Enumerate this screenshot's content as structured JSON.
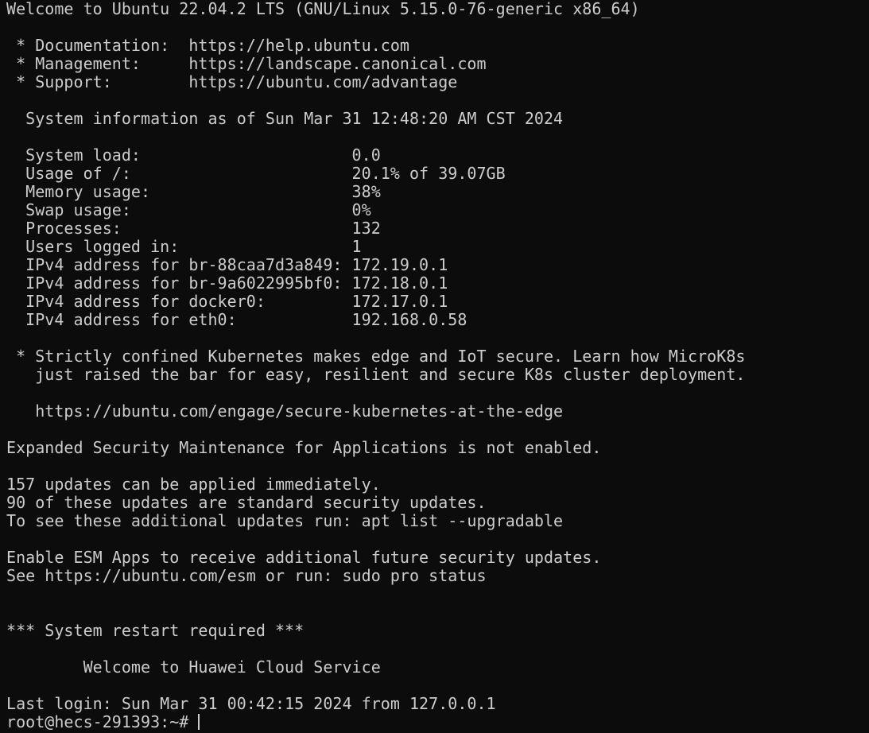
{
  "terminal": {
    "lines": [
      "Welcome to Ubuntu 22.04.2 LTS (GNU/Linux 5.15.0-76-generic x86_64)",
      "",
      " * Documentation:  https://help.ubuntu.com",
      " * Management:     https://landscape.canonical.com",
      " * Support:        https://ubuntu.com/advantage",
      "",
      "  System information as of Sun Mar 31 12:48:20 AM CST 2024",
      "",
      "  System load:                      0.0",
      "  Usage of /:                       20.1% of 39.07GB",
      "  Memory usage:                     38%",
      "  Swap usage:                       0%",
      "  Processes:                        132",
      "  Users logged in:                  1",
      "  IPv4 address for br-88caa7d3a849: 172.19.0.1",
      "  IPv4 address for br-9a6022995bf0: 172.18.0.1",
      "  IPv4 address for docker0:         172.17.0.1",
      "  IPv4 address for eth0:            192.168.0.58",
      "",
      " * Strictly confined Kubernetes makes edge and IoT secure. Learn how MicroK8s",
      "   just raised the bar for easy, resilient and secure K8s cluster deployment.",
      "",
      "   https://ubuntu.com/engage/secure-kubernetes-at-the-edge",
      "",
      "Expanded Security Maintenance for Applications is not enabled.",
      "",
      "157 updates can be applied immediately.",
      "90 of these updates are standard security updates.",
      "To see these additional updates run: apt list --upgradable",
      "",
      "Enable ESM Apps to receive additional future security updates.",
      "See https://ubuntu.com/esm or run: sudo pro status",
      "",
      "",
      "*** System restart required ***",
      "",
      "        Welcome to Huawei Cloud Service",
      "",
      "Last login: Sun Mar 31 00:42:15 2024 from 127.0.0.1"
    ],
    "prompt": "root@hecs-291393:~#",
    "input_value": ""
  },
  "colors": {
    "background": "#0c0c0c",
    "foreground": "#cccccc"
  }
}
